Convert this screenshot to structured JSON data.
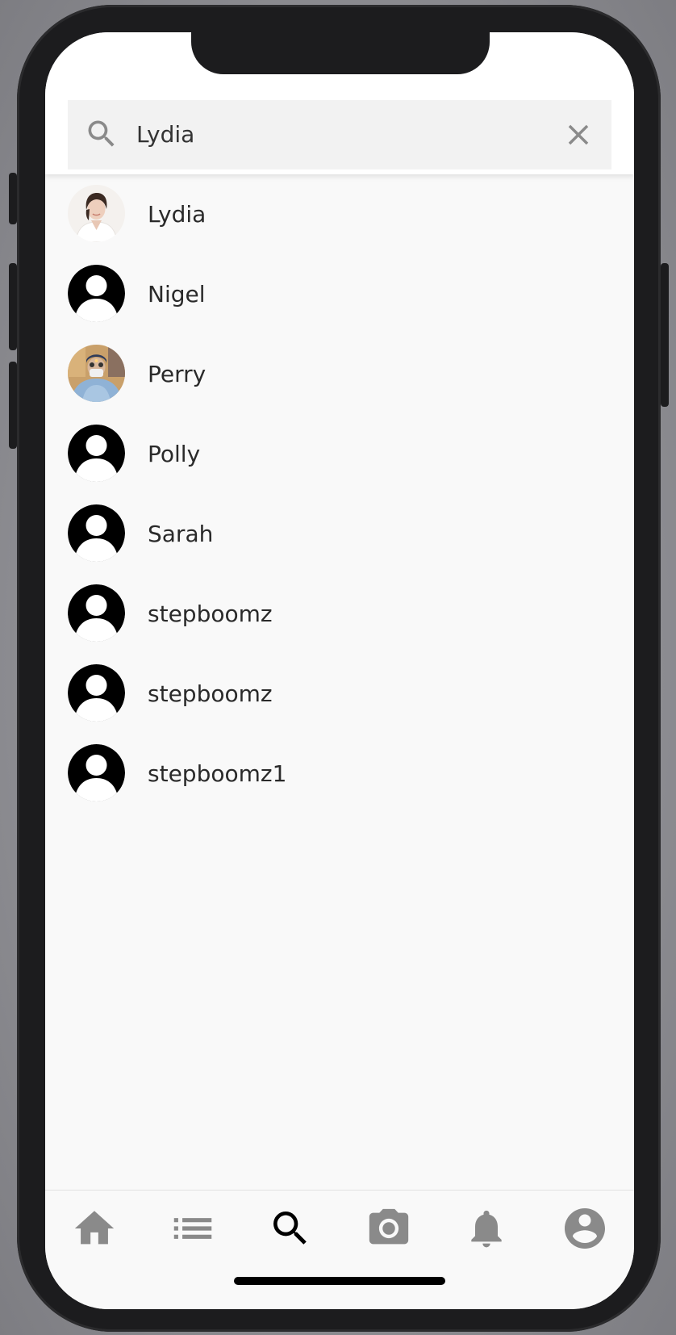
{
  "search": {
    "query": "Lydia",
    "icon": "search-icon",
    "clear_icon": "close-icon"
  },
  "results": [
    {
      "name": "Lydia",
      "avatar": "photo-woman"
    },
    {
      "name": "Nigel",
      "avatar": "default-avatar"
    },
    {
      "name": "Perry",
      "avatar": "photo-man-blue"
    },
    {
      "name": "Polly",
      "avatar": "default-avatar"
    },
    {
      "name": "Sarah",
      "avatar": "default-avatar"
    },
    {
      "name": "stepboomz",
      "avatar": "default-avatar"
    },
    {
      "name": "stepboomz",
      "avatar": "default-avatar"
    },
    {
      "name": "stepboomz1",
      "avatar": "default-avatar"
    }
  ],
  "bottom_nav": {
    "items": [
      {
        "icon": "home-icon",
        "active": false
      },
      {
        "icon": "list-icon",
        "active": false
      },
      {
        "icon": "search-icon",
        "active": true
      },
      {
        "icon": "camera-icon",
        "active": false
      },
      {
        "icon": "bell-icon",
        "active": false
      },
      {
        "icon": "account-circle-icon",
        "active": false
      }
    ]
  },
  "colors": {
    "active_icon": "#000000",
    "inactive_icon": "#8a8a8a",
    "search_field_bg": "#f2f2f2",
    "list_bg": "#f9f9f9",
    "text": "#2a2a2a"
  }
}
